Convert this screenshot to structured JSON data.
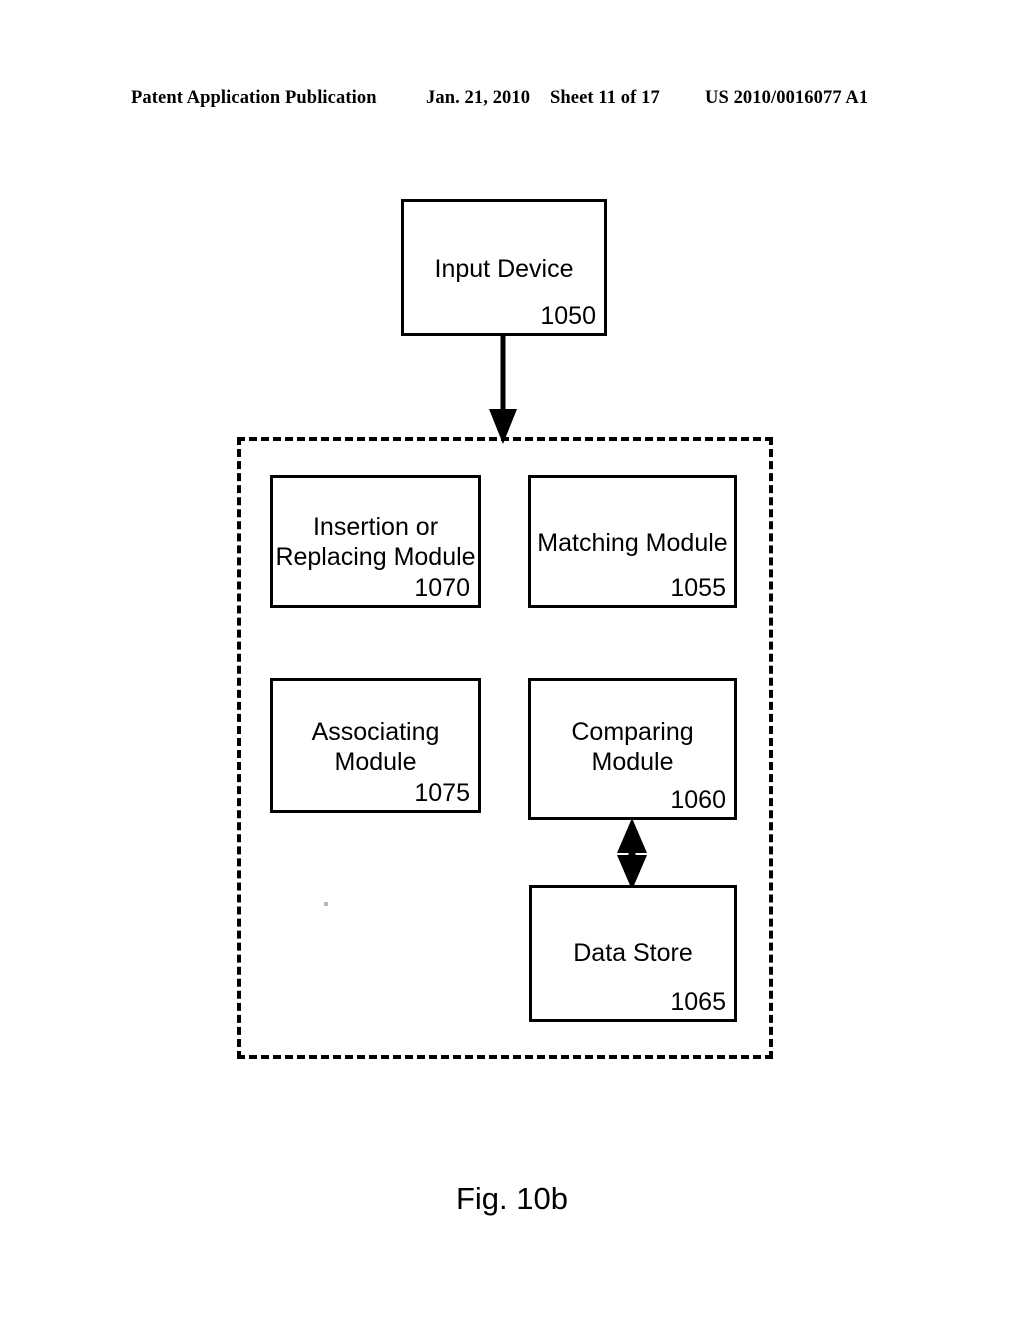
{
  "page": {
    "header": {
      "publication": "Patent Application Publication",
      "date": "Jan. 21, 2010",
      "sheet": "Sheet 11 of 17",
      "patent_number": "US 2010/0016077 A1"
    },
    "figure_caption": "Fig. 10b",
    "ink_color": "#000000",
    "background_color": "#ffffff"
  },
  "diagram": {
    "type": "block-diagram",
    "boundary": {
      "style": "dashed",
      "label": "system-boundary"
    },
    "boxes": [
      {
        "id": "input-device",
        "label": "Input Device",
        "reference_numeral": "1050",
        "inside_boundary": false
      },
      {
        "id": "insertion-replacing-module",
        "label": "Insertion or\nReplacing Module",
        "reference_numeral": "1070",
        "inside_boundary": true
      },
      {
        "id": "matching-module",
        "label": "Matching Module",
        "reference_numeral": "1055",
        "inside_boundary": true
      },
      {
        "id": "associating-module",
        "label": "Associating\nModule",
        "reference_numeral": "1075",
        "inside_boundary": true
      },
      {
        "id": "comparing-module",
        "label": "Comparing\nModule",
        "reference_numeral": "1060",
        "inside_boundary": true
      },
      {
        "id": "data-store",
        "label": "Data Store",
        "reference_numeral": "1065",
        "inside_boundary": true
      }
    ],
    "connectors": [
      {
        "id": "input-to-system",
        "from": "input-device",
        "to": "system-boundary",
        "arrowheads": "single-down"
      },
      {
        "id": "comparing-to-data-store",
        "from": "comparing-module",
        "to": "data-store",
        "arrowheads": "double"
      }
    ]
  }
}
